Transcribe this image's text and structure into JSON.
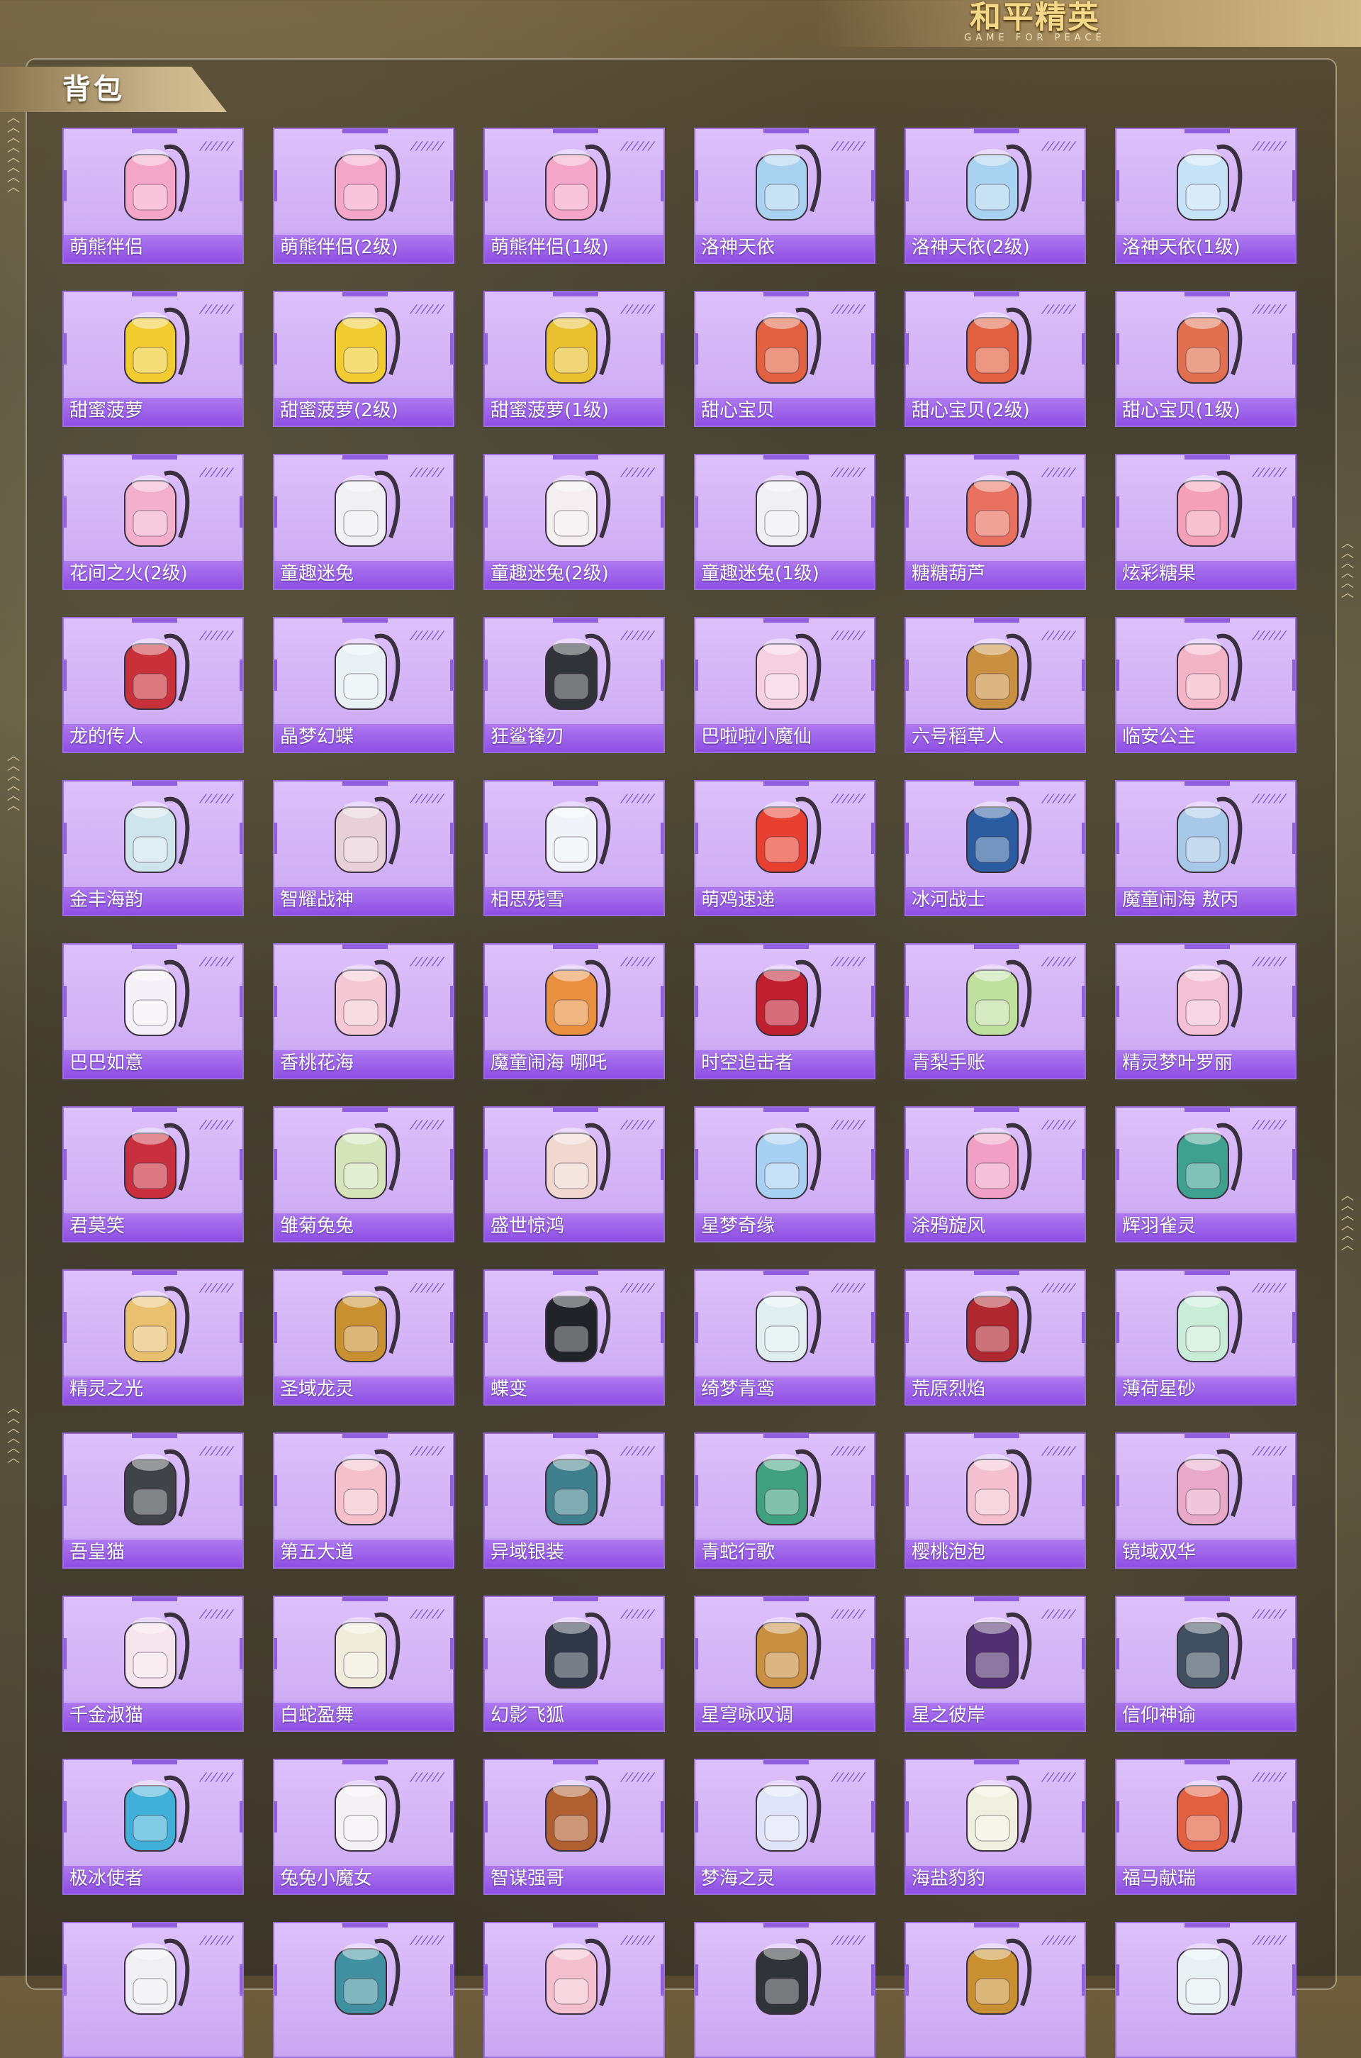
{
  "logo": {
    "cn": "和平精英",
    "en": "GAME FOR PEACE"
  },
  "panel": {
    "title": "背包"
  },
  "items": [
    {
      "name": "萌熊伴侣",
      "icon": "teddy-bear-backpack-icon",
      "color": "#f4a6c8"
    },
    {
      "name": "萌熊伴侣(2级)",
      "icon": "teddy-bear-backpack-icon",
      "color": "#f4a6c8"
    },
    {
      "name": "萌熊伴侣(1级)",
      "icon": "teddy-bear-backpack-icon",
      "color": "#f4a6c8"
    },
    {
      "name": "洛神天依",
      "icon": "ice-crystal-backpack-icon",
      "color": "#a9d2f0"
    },
    {
      "name": "洛神天依(2级)",
      "icon": "ice-crystal-backpack-icon",
      "color": "#a9d2f0"
    },
    {
      "name": "洛神天依(1级)",
      "icon": "ice-crystal-backpack-icon",
      "color": "#c6e2f6"
    },
    {
      "name": "甜蜜菠萝",
      "icon": "pineapple-backpack-icon",
      "color": "#f0cc30"
    },
    {
      "name": "甜蜜菠萝(2级)",
      "icon": "pineapple-backpack-icon",
      "color": "#f0cc30"
    },
    {
      "name": "甜蜜菠萝(1级)",
      "icon": "pineapple-backpack-icon",
      "color": "#e8c030"
    },
    {
      "name": "甜心宝贝",
      "icon": "milkshake-backpack-icon",
      "color": "#e06040"
    },
    {
      "name": "甜心宝贝(2级)",
      "icon": "milkshake-backpack-icon",
      "color": "#e06040"
    },
    {
      "name": "甜心宝贝(1级)",
      "icon": "milkshake-backpack-icon",
      "color": "#e07050"
    },
    {
      "name": "花间之火(2级)",
      "icon": "flower-backpack-icon",
      "color": "#f2b0cc"
    },
    {
      "name": "童趣迷兔",
      "icon": "bunny-backpack-icon",
      "color": "#f0f0f4"
    },
    {
      "name": "童趣迷兔(2级)",
      "icon": "bunny-backpack-icon",
      "color": "#f4eef0"
    },
    {
      "name": "童趣迷兔(1级)",
      "icon": "bunny-backpack-icon",
      "color": "#f0f0f4"
    },
    {
      "name": "糖糖葫芦",
      "icon": "candy-gourd-backpack-icon",
      "color": "#e87060"
    },
    {
      "name": "炫彩糖果",
      "icon": "donut-backpack-icon",
      "color": "#f4a0b8"
    },
    {
      "name": "龙的传人",
      "icon": "red-schoolbag-icon",
      "color": "#c8303a"
    },
    {
      "name": "晶梦幻蝶",
      "icon": "butterfly-backpack-icon",
      "color": "#e8f0f4"
    },
    {
      "name": "狂鲨锋刃",
      "icon": "shark-backpack-icon",
      "color": "#303438"
    },
    {
      "name": "巴啦啦小魔仙",
      "icon": "fairy-backpack-icon",
      "color": "#f6d0e0"
    },
    {
      "name": "六号稻草人",
      "icon": "scarecrow-backpack-icon",
      "color": "#c89040"
    },
    {
      "name": "临安公主",
      "icon": "princess-backpack-icon",
      "color": "#f4b4c8"
    },
    {
      "name": "金丰海韵",
      "icon": "seashell-backpack-icon",
      "color": "#d0e4ec"
    },
    {
      "name": "智耀战神",
      "icon": "warrior-backpack-icon",
      "color": "#e8d0d8"
    },
    {
      "name": "相思残雪",
      "icon": "snow-backpack-icon",
      "color": "#f0f4f8"
    },
    {
      "name": "萌鸡速递",
      "icon": "chick-backpack-icon",
      "color": "#e84030"
    },
    {
      "name": "冰河战士",
      "icon": "blue-pack-icon",
      "color": "#2c5ca0"
    },
    {
      "name": "魔童闹海 敖丙",
      "icon": "dragon-orb-backpack-icon",
      "color": "#a8c8e8"
    },
    {
      "name": "巴巴如意",
      "icon": "ghost-backpack-icon",
      "color": "#f6f0f8"
    },
    {
      "name": "香桃花海",
      "icon": "peach-blossom-backpack-icon",
      "color": "#f4c8d4"
    },
    {
      "name": "魔童闹海 哪吒",
      "icon": "fire-orb-backpack-icon",
      "color": "#e89040"
    },
    {
      "name": "时空追击者",
      "icon": "hero-backpack-icon",
      "color": "#c02030"
    },
    {
      "name": "青梨手账",
      "icon": "pear-backpack-icon",
      "color": "#c0e0a0"
    },
    {
      "name": "精灵梦叶罗丽",
      "icon": "heart-backpack-icon",
      "color": "#f4c0d4"
    },
    {
      "name": "君莫笑",
      "icon": "winged-backpack-icon",
      "color": "#c83040"
    },
    {
      "name": "雏菊兔兔",
      "icon": "daisy-bunny-backpack-icon",
      "color": "#d4e4b8"
    },
    {
      "name": "盛世惊鸿",
      "icon": "phoenix-backpack-icon",
      "color": "#f0d8d0"
    },
    {
      "name": "星梦奇缘",
      "icon": "swan-backpack-icon",
      "color": "#a8d0f0"
    },
    {
      "name": "涂鸦旋风",
      "icon": "graffiti-backpack-icon",
      "color": "#f0a0c4"
    },
    {
      "name": "辉羽雀灵",
      "icon": "feather-backpack-icon",
      "color": "#40a090"
    },
    {
      "name": "精灵之光",
      "icon": "lantern-backpack-icon",
      "color": "#e8c070"
    },
    {
      "name": "圣域龙灵",
      "icon": "golden-dragon-backpack-icon",
      "color": "#c89030"
    },
    {
      "name": "蝶变",
      "icon": "black-butterfly-backpack-icon",
      "color": "#202428"
    },
    {
      "name": "绮梦青鸾",
      "icon": "crane-backpack-icon",
      "color": "#e0eef0"
    },
    {
      "name": "荒原烈焰",
      "icon": "flame-backpack-icon",
      "color": "#b02830"
    },
    {
      "name": "薄荷星砂",
      "icon": "mint-pouch-icon",
      "color": "#c8ecd8"
    },
    {
      "name": "吾皇猫",
      "icon": "cat-backpack-icon",
      "color": "#404448"
    },
    {
      "name": "第五大道",
      "icon": "quilted-bag-icon",
      "color": "#f4c0cc"
    },
    {
      "name": "异域银装",
      "icon": "tech-backpack-icon",
      "color": "#40808c"
    },
    {
      "name": "青蛇行歌",
      "icon": "green-snake-backpack-icon",
      "color": "#40a080"
    },
    {
      "name": "樱桃泡泡",
      "icon": "bow-backpack-icon",
      "color": "#f4c0d0"
    },
    {
      "name": "镜域双华",
      "icon": "mirror-heart-backpack-icon",
      "color": "#e8a8c8"
    },
    {
      "name": "千金淑猫",
      "icon": "lady-cat-backpack-icon",
      "color": "#f6e4ec"
    },
    {
      "name": "白蛇盈舞",
      "icon": "white-snake-backpack-icon",
      "color": "#f0ecdc"
    },
    {
      "name": "幻影飞狐",
      "icon": "fox-tech-backpack-icon",
      "color": "#303848"
    },
    {
      "name": "星穹咏叹调",
      "icon": "harp-backpack-icon",
      "color": "#c89040"
    },
    {
      "name": "星之彼岸",
      "icon": "space-helmet-backpack-icon",
      "color": "#503070"
    },
    {
      "name": "信仰神谕",
      "icon": "angel-backpack-icon",
      "color": "#405060"
    },
    {
      "name": "极冰使者",
      "icon": "ice-shard-backpack-icon",
      "color": "#40b0d8"
    },
    {
      "name": "兔兔小魔女",
      "icon": "witch-bunny-backpack-icon",
      "color": "#f4f0f4"
    },
    {
      "name": "智谋强哥",
      "icon": "bear-head-backpack-icon",
      "color": "#b06030"
    },
    {
      "name": "梦海之灵",
      "icon": "jellyfish-backpack-icon",
      "color": "#e0e4f8"
    },
    {
      "name": "海盐豹豹",
      "icon": "leopard-backpack-icon",
      "color": "#f0f0e0"
    },
    {
      "name": "福马献瑞",
      "icon": "lucky-horse-backpack-icon",
      "color": "#e06040"
    },
    {
      "name": "",
      "icon": "bunny-backpack-icon",
      "color": "#f0f0f4"
    },
    {
      "name": "",
      "icon": "orb-backpack-icon",
      "color": "#4090a0"
    },
    {
      "name": "",
      "icon": "pink-backpack-icon",
      "color": "#f4c0d0"
    },
    {
      "name": "",
      "icon": "sword-backpack-icon",
      "color": "#303438"
    },
    {
      "name": "",
      "icon": "gold-backpack-icon",
      "color": "#c89030"
    },
    {
      "name": "",
      "icon": "white-backpack-icon",
      "color": "#e8f0f4"
    }
  ]
}
